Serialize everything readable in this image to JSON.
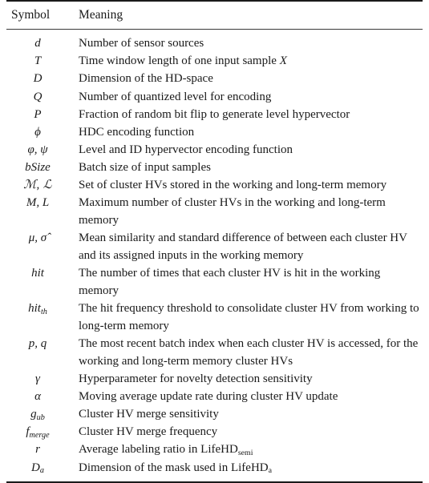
{
  "table": {
    "columns": [
      "Symbol",
      "Meaning"
    ],
    "rows": [
      {
        "symbol": "d",
        "meaning": "Number of sensor sources"
      },
      {
        "symbol": "T",
        "meaning": "Time window length of one input sample X"
      },
      {
        "symbol": "D",
        "meaning": "Dimension of the HD-space"
      },
      {
        "symbol": "Q",
        "meaning": "Number of quantized level for encoding"
      },
      {
        "symbol": "P",
        "meaning": "Fraction of random bit flip to generate level hypervector"
      },
      {
        "symbol": "ϕ",
        "meaning": "HDC encoding function"
      },
      {
        "symbol": "φ, ψ",
        "meaning": "Level and ID hypervector encoding function"
      },
      {
        "symbol": "bSize",
        "meaning": "Batch size of input samples"
      },
      {
        "symbol": "ℳ, ℒ",
        "meaning": "Set of cluster HVs stored in the working and long-term memory"
      },
      {
        "symbol": "M, L",
        "meaning": "Maximum number of cluster HVs in the working and long-term memory"
      },
      {
        "symbol": "μ, σ̂",
        "meaning": "Mean similarity and standard difference of between each cluster HV and its assigned inputs in the working memory"
      },
      {
        "symbol": "hit",
        "meaning": "The number of times that each cluster HV is hit in the working memory"
      },
      {
        "symbol": "hit_th",
        "meaning": "The hit frequency threshold to consolidate cluster HV from working to long-term memory"
      },
      {
        "symbol": "p, q",
        "meaning": "The most recent batch index when each cluster HV is accessed, for the working and long-term memory cluster HVs"
      },
      {
        "symbol": "γ",
        "meaning": "Hyperparameter for novelty detection sensitivity"
      },
      {
        "symbol": "α",
        "meaning": "Moving average update rate during cluster HV update"
      },
      {
        "symbol": "g_ub",
        "meaning": "Cluster HV merge sensitivity"
      },
      {
        "symbol": "f_merge",
        "meaning": "Cluster HV merge frequency"
      },
      {
        "symbol": "r",
        "meaning": "Average labeling ratio in LifeHD_semi"
      },
      {
        "symbol": "D_a",
        "meaning": "Dimension of the mask used in LifeHD_a"
      }
    ]
  },
  "symbol_parts": {
    "hit_th": {
      "base": "hit",
      "sub": "th"
    },
    "g_ub": {
      "base": "g",
      "sub": "ub"
    },
    "f_merge": {
      "base": "f",
      "sub": "merge"
    },
    "D_a": {
      "base": "D",
      "sub": "a"
    }
  },
  "meaning_parts": {
    "lifehd_semi": {
      "pre": "Average labeling ratio in LifeHD",
      "sub": "semi"
    },
    "lifehd_a": {
      "pre": "Dimension of the mask used in LifeHD",
      "sub": "a"
    },
    "sample_X": {
      "pre": "Time window length of one input sample ",
      "var": "X"
    }
  },
  "colors": {
    "text": "#1a1a1a",
    "rule": "#1a1a1a",
    "background": "#ffffff"
  }
}
